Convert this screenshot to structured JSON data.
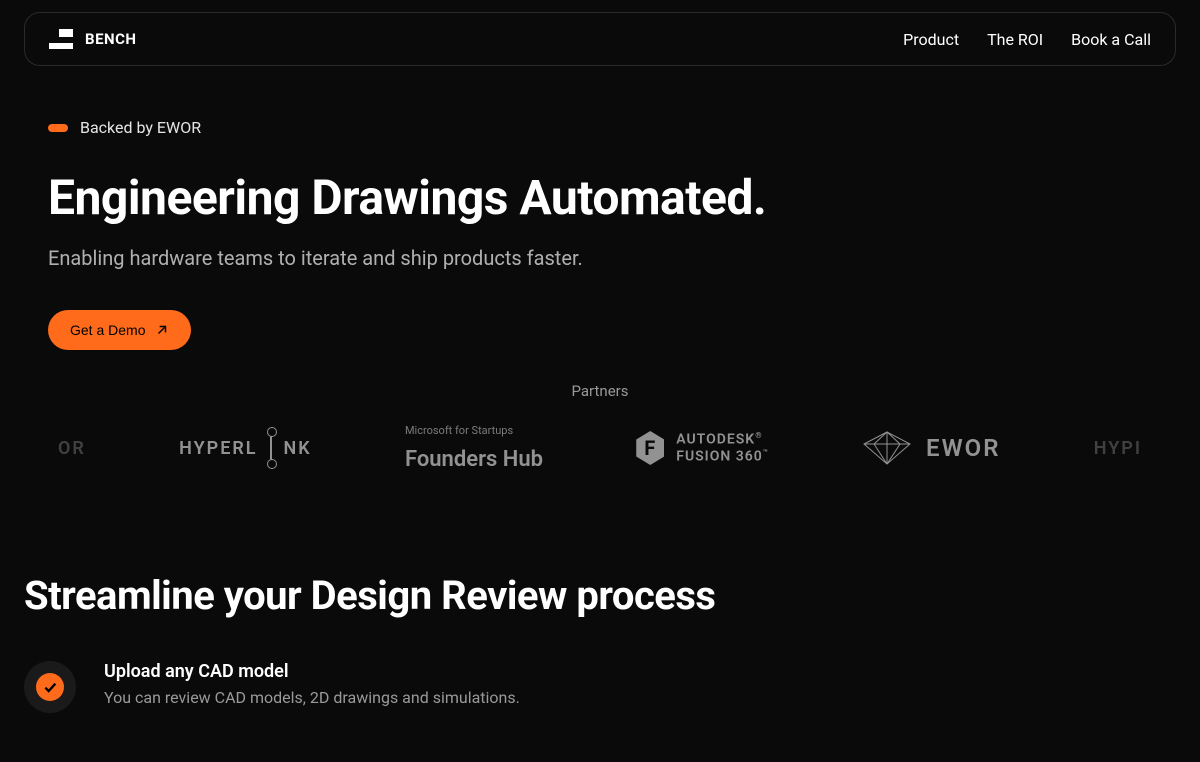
{
  "nav": {
    "logo": "BENCH",
    "links": [
      "Product",
      "The ROI",
      "Book a Call"
    ]
  },
  "hero": {
    "backed_label": "Backed by EWOR",
    "title": "Engineering Drawings Automated.",
    "subtitle": "Enabling hardware teams to iterate and ship products faster.",
    "cta": "Get a Demo"
  },
  "partners": {
    "label": "Partners",
    "items": [
      "EWOR",
      "HYPERLINK",
      "Microsoft for Startups Founders Hub",
      "AUTODESK FUSION 360",
      "EWOR",
      "HYPERLINK"
    ],
    "founders_top": "Microsoft for Startups",
    "founders_bottom": "Founders Hub",
    "fusion_top": "AUTODESK",
    "fusion_bottom": "FUSION 360"
  },
  "streamline": {
    "title": "Streamline your Design Review process",
    "feature_title": "Upload any CAD model",
    "feature_desc": "You can review CAD models, 2D drawings and simulations."
  }
}
